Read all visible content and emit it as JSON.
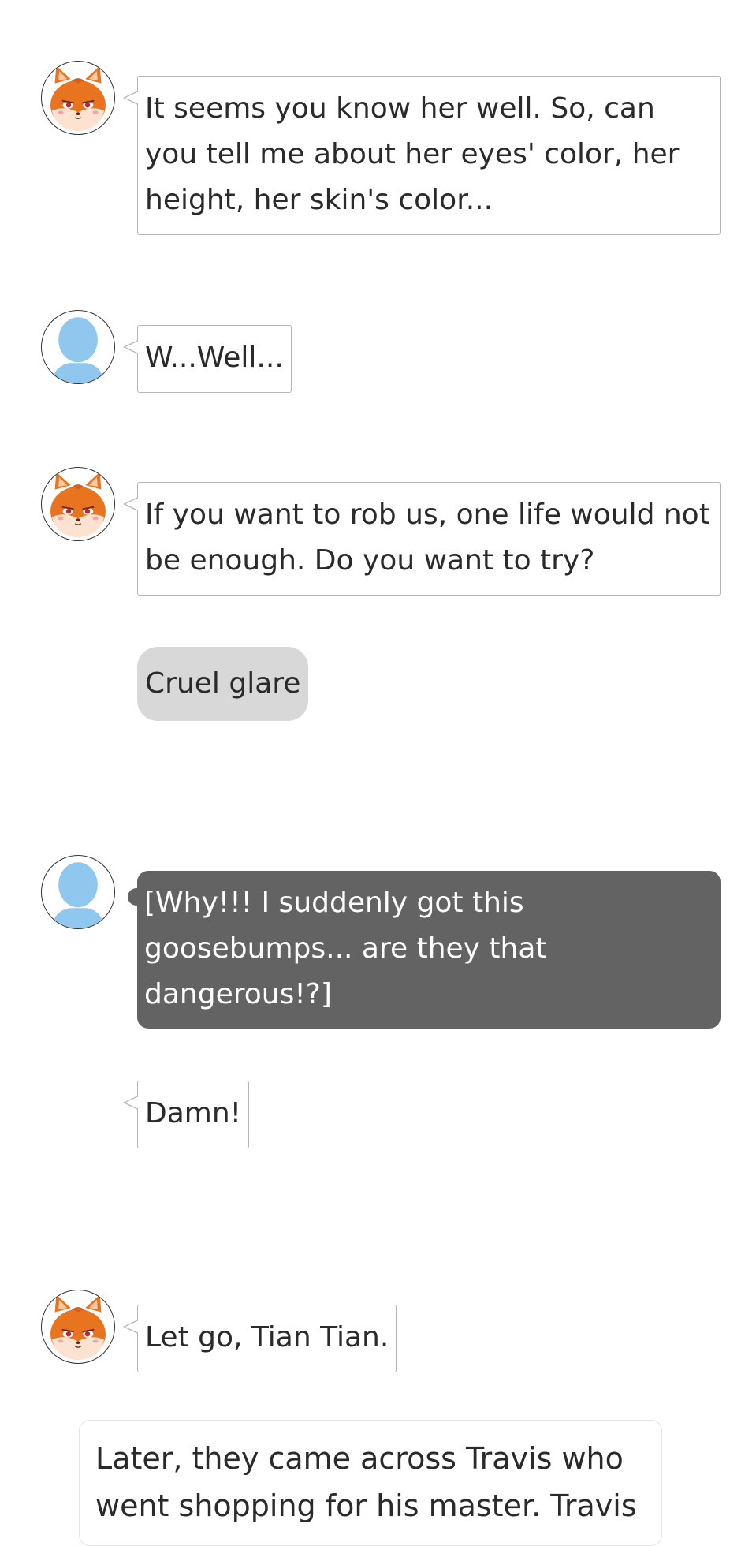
{
  "messages": [
    {
      "speaker": "fox",
      "icon": "fox-avatar-icon",
      "text": "It seems you know her well. So, can you tell me about her eyes' color, her height, her skin's color..."
    },
    {
      "speaker": "user",
      "icon": "user-silhouette-icon",
      "text": "W...Well..."
    },
    {
      "speaker": "fox",
      "icon": "fox-avatar-icon",
      "text": "If you want to rob us, one life would not be enough. Do you want to try?"
    },
    {
      "speaker": "fox",
      "type": "action",
      "text": "Cruel glare"
    },
    {
      "speaker": "user",
      "icon": "user-silhouette-icon",
      "type": "thought",
      "text": "[Why!!! I suddenly got this goosebumps... are they that dangerous!?]"
    },
    {
      "speaker": "user",
      "text": "Damn!"
    },
    {
      "speaker": "fox",
      "icon": "fox-avatar-icon",
      "text": "Let go, Tian Tian."
    }
  ],
  "narration": {
    "text": "Later, they came across Travis who went shopping for his master. Travis"
  },
  "colors": {
    "thought_bg": "#636363",
    "action_bg": "#d8d8d8",
    "bubble_border": "#b5b5b5",
    "fox_orange": "#e8741f",
    "user_blue": "#8fc7ee"
  }
}
